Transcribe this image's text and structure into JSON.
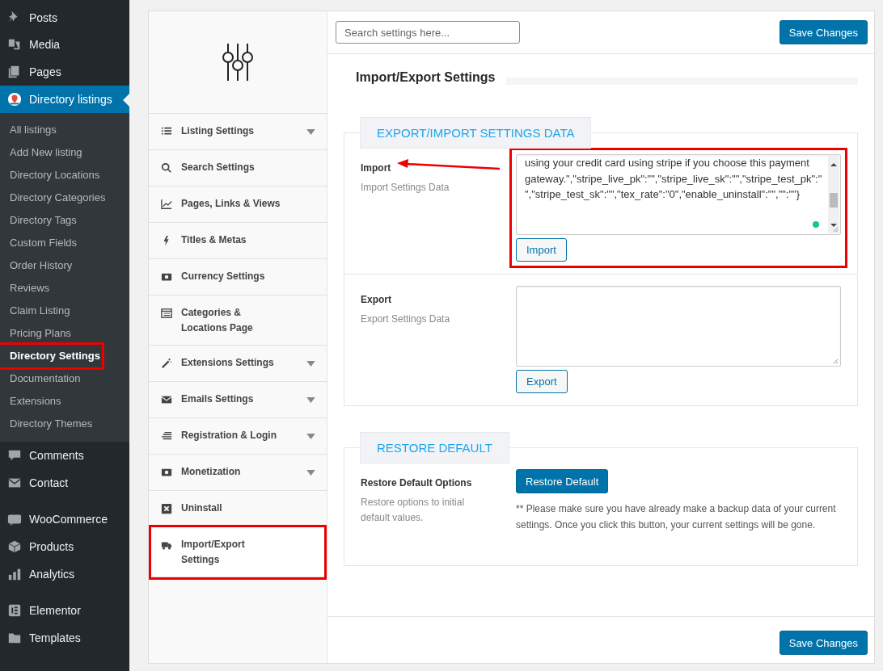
{
  "admin_menu_groups": [
    [
      {
        "label": "Posts",
        "selected": false
      },
      {
        "label": "Media",
        "selected": false
      },
      {
        "label": "Pages",
        "selected": false
      },
      {
        "label": "Directory listings",
        "selected": true,
        "children": [
          {
            "label": "All listings",
            "selected": false,
            "annotated": false
          },
          {
            "label": "Add New listing",
            "selected": false,
            "annotated": false
          },
          {
            "label": "Directory Locations",
            "selected": false,
            "annotated": false
          },
          {
            "label": "Directory Categories",
            "selected": false,
            "annotated": false
          },
          {
            "label": "Directory Tags",
            "selected": false,
            "annotated": false
          },
          {
            "label": "Custom Fields",
            "selected": false,
            "annotated": false
          },
          {
            "label": "Order History",
            "selected": false,
            "annotated": false
          },
          {
            "label": "Reviews",
            "selected": false,
            "annotated": false
          },
          {
            "label": "Claim Listing",
            "selected": false,
            "annotated": false
          },
          {
            "label": "Pricing Plans",
            "selected": false,
            "annotated": false
          },
          {
            "label": "Directory Settings",
            "selected": true,
            "annotated": true
          },
          {
            "label": "Documentation",
            "selected": false,
            "annotated": false
          },
          {
            "label": "Extensions",
            "selected": false,
            "annotated": false
          },
          {
            "label": "Directory Themes",
            "selected": false,
            "annotated": false
          }
        ]
      }
    ],
    [
      {
        "label": "Comments",
        "selected": false
      },
      {
        "label": "Contact",
        "selected": false
      }
    ],
    [
      {
        "label": "WooCommerce",
        "selected": false
      },
      {
        "label": "Products",
        "selected": false
      },
      {
        "label": "Analytics",
        "selected": false
      }
    ],
    [
      {
        "label": "Elementor",
        "selected": false
      },
      {
        "label": "Templates",
        "selected": false
      }
    ]
  ],
  "settings_nav": [
    {
      "lines": [
        "Listing Settings"
      ],
      "has_dropdown": true,
      "selected": false,
      "annotated": false
    },
    {
      "lines": [
        "Search Settings"
      ],
      "has_dropdown": false,
      "selected": false,
      "annotated": false
    },
    {
      "lines": [
        "Pages, Links & Views"
      ],
      "has_dropdown": false,
      "selected": false,
      "annotated": false
    },
    {
      "lines": [
        "Titles & Metas"
      ],
      "has_dropdown": false,
      "selected": false,
      "annotated": false
    },
    {
      "lines": [
        "Currency Settings"
      ],
      "has_dropdown": false,
      "selected": false,
      "annotated": false
    },
    {
      "lines": [
        "Categories &",
        "Locations Page"
      ],
      "has_dropdown": false,
      "selected": false,
      "annotated": false
    },
    {
      "lines": [
        "Extensions Settings"
      ],
      "has_dropdown": true,
      "selected": false,
      "annotated": false
    },
    {
      "lines": [
        "Emails Settings"
      ],
      "has_dropdown": true,
      "selected": false,
      "annotated": false
    },
    {
      "lines": [
        "Registration & Login"
      ],
      "has_dropdown": true,
      "selected": false,
      "annotated": false
    },
    {
      "lines": [
        "Monetization"
      ],
      "has_dropdown": true,
      "selected": false,
      "annotated": false
    },
    {
      "lines": [
        "Uninstall"
      ],
      "has_dropdown": false,
      "selected": false,
      "annotated": false
    },
    {
      "lines": [
        "Import/Export",
        "Settings"
      ],
      "has_dropdown": false,
      "selected": true,
      "annotated": true
    }
  ],
  "search": {
    "placeholder": "Search settings here..."
  },
  "save_button": "Save Changes",
  "page_title": "Import/Export Settings",
  "sections": [
    {
      "title": "EXPORT/IMPORT SETTINGS DATA",
      "rows": [
        {
          "kind": "textarea",
          "label": "Import",
          "description": "Import Settings Data",
          "value": "using your credit card using stripe if you choose this payment gateway.\",\"stripe_live_pk\":\"\",\"stripe_live_sk\":\"\",\"stripe_test_pk\":\"\",\"stripe_test_sk\":\"\",\"tex_rate\":\"0\",\"enable_uninstall\":\"\",\"\":\"\"}",
          "button": "Import",
          "annotated": true
        },
        {
          "kind": "textarea",
          "label": "Export",
          "description": "Export Settings Data",
          "button": "Export",
          "annotated": false
        }
      ]
    },
    {
      "title": "RESTORE DEFAULT",
      "rows": [
        {
          "kind": "action",
          "label": "Restore Default Options",
          "description": "Restore options to initial default values.",
          "button": "Restore Default",
          "note": "** Please make sure you have already make a backup data of your current settings. Once you click this button, your current settings will be gone.",
          "annotated": false
        }
      ]
    }
  ],
  "footer_save_button": "Save Changes"
}
